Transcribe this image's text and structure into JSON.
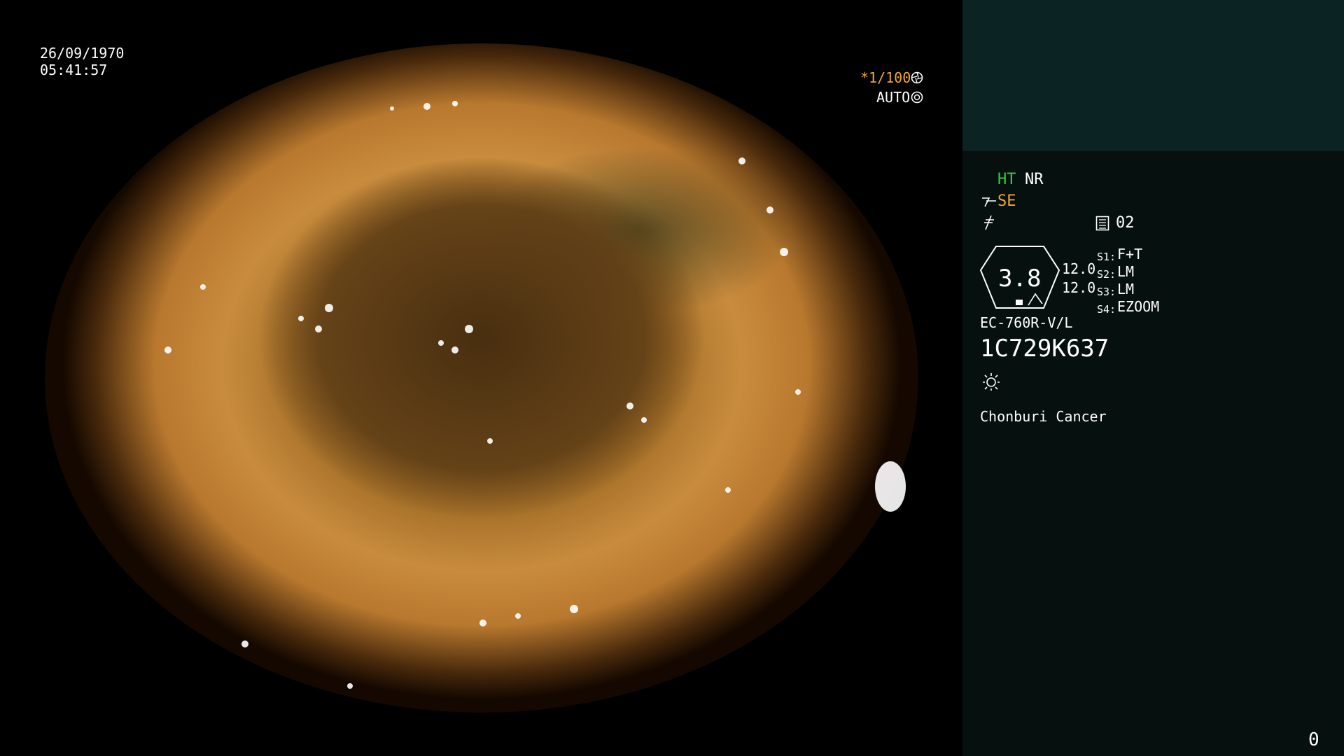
{
  "image": {
    "date": "26/09/1970",
    "time": "05:41:57",
    "shutter": "*1/100",
    "exposure_mode": "AUTO",
    "shutter_icon": "aperture-icon",
    "auto_icon": "iris-icon"
  },
  "panel": {
    "ht_label": "HT",
    "nr_label": "NR",
    "se_label": "SE",
    "se_icon": "structure-enhance-icon",
    "filter_icon": "signal-off-icon",
    "memory_icon": "memory-card-icon",
    "memory_value": "02",
    "gauge_value": "3.8",
    "gauge_val_top": "12.0",
    "gauge_val_bottom": "12.0",
    "switches": [
      {
        "key": "S1:",
        "value": "F+T"
      },
      {
        "key": "S2:",
        "value": "LM"
      },
      {
        "key": "S3:",
        "value": "LM"
      },
      {
        "key": "S4:",
        "value": "EZOOM"
      }
    ],
    "scope_model": "EC-760R-V/L",
    "serial": "1C729K637",
    "light_icon": "sun-icon",
    "institution": "Chonburi Cancer",
    "counter": "0"
  },
  "colors": {
    "panel_bg": "#06100f",
    "panel_top_bg": "#0b2322",
    "accent_green": "#2ecc40",
    "accent_orange": "#f0a830"
  }
}
